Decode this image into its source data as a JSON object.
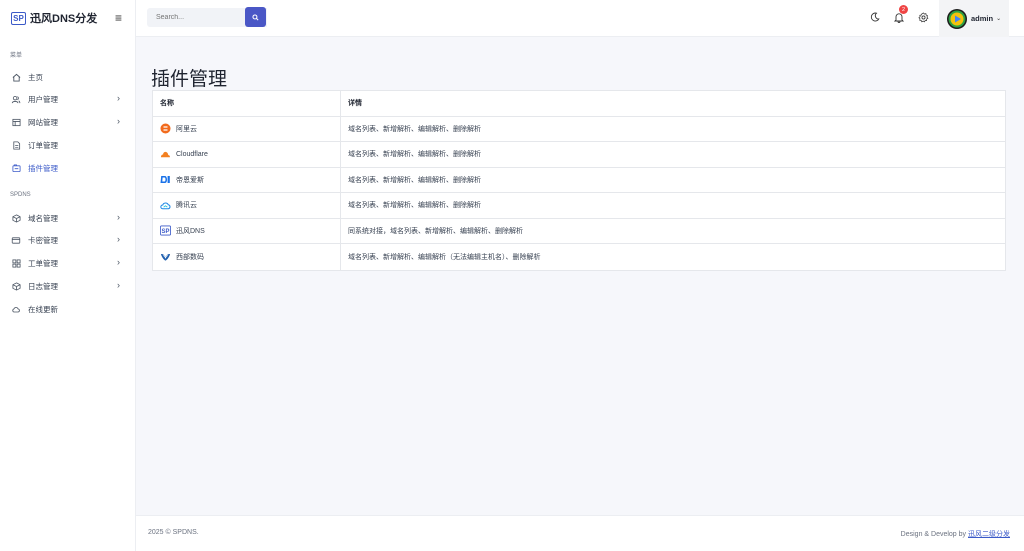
{
  "brand": {
    "logo_text": "SP",
    "name": "迅风DNS分发"
  },
  "sidebar": {
    "section1_title": "菜单",
    "section2_title": "SPDNS",
    "items": [
      {
        "label": "主页"
      },
      {
        "label": "用户管理"
      },
      {
        "label": "网站管理"
      },
      {
        "label": "订单管理"
      },
      {
        "label": "插件管理"
      },
      {
        "label": "域名管理"
      },
      {
        "label": "卡密管理"
      },
      {
        "label": "工单管理"
      },
      {
        "label": "日志管理"
      },
      {
        "label": "在线更新"
      }
    ]
  },
  "topbar": {
    "search_placeholder": "Search...",
    "notification_count": "2",
    "user_name": "admin"
  },
  "page": {
    "title": "插件管理"
  },
  "table": {
    "headers": [
      "名称",
      "详情"
    ],
    "rows": [
      {
        "name": "阿里云",
        "detail": "域名列表、新增解析、编辑解析、删除解析"
      },
      {
        "name": "Cloudflare",
        "detail": "域名列表、新增解析、编辑解析、删除解析"
      },
      {
        "name": "帝恩爱斯",
        "detail": "域名列表、新增解析、编辑解析、删除解析"
      },
      {
        "name": "腾讯云",
        "detail": "域名列表、新增解析、编辑解析、删除解析"
      },
      {
        "name": "迅风DNS",
        "detail": "同系统对接，域名列表、新增解析、编辑解析、删除解析"
      },
      {
        "name": "西部数码",
        "detail": "域名列表、新增解析、编辑解析（无法编辑主机名）、删除解析"
      }
    ]
  },
  "footer": {
    "copyright": "2025 © SPDNS.",
    "credits_prefix": "Design & Develop by ",
    "credits_link": "迅风二级分发"
  },
  "colors": {
    "accent": "#3b5ac8",
    "button": "#4a57c6",
    "badge": "#ef4444"
  }
}
